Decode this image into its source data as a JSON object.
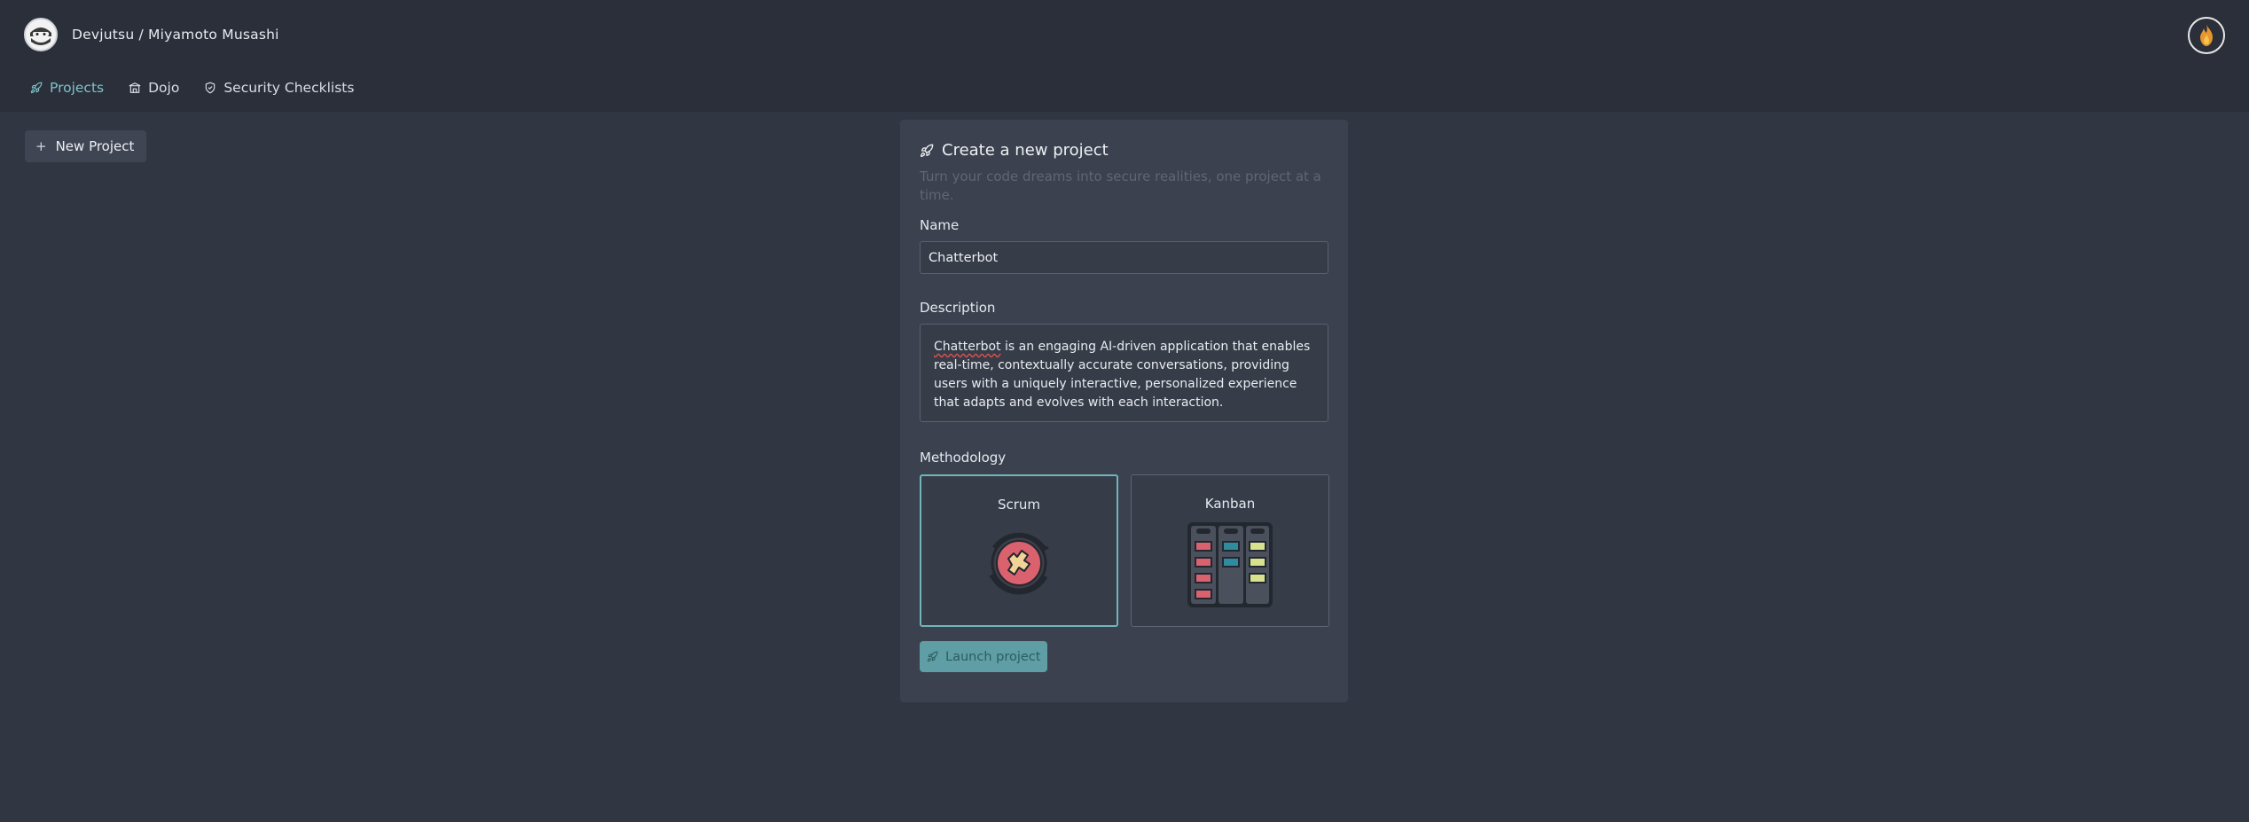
{
  "header": {
    "breadcrumb": "Devjutsu / Miyamoto Musashi",
    "logo_icon": "ninja-icon",
    "user_avatar_icon": "flame-icon"
  },
  "nav": {
    "items": [
      {
        "label": "Projects",
        "icon": "rocket-icon",
        "active": true
      },
      {
        "label": "Dojo",
        "icon": "dojo-icon",
        "active": false
      },
      {
        "label": "Security Checklists",
        "icon": "shield-icon",
        "active": false
      }
    ]
  },
  "toolbar": {
    "new_project_label": "New Project",
    "new_project_icon": "plus-icon"
  },
  "form": {
    "title": "Create a new project",
    "subtitle": "Turn your code dreams into secure realities, one project at a time.",
    "name_label": "Name",
    "name_value": "Chatterbot",
    "description_label": "Description",
    "description_first_word": "Chatterbot",
    "description_rest": " is an engaging AI-driven application that enables real-time, contextually accurate conversations, providing users with a uniquely interactive, personalized experience that adapts and evolves with each interaction.",
    "methodology_label": "Methodology",
    "methodologies": [
      {
        "label": "Scrum",
        "selected": true,
        "icon": "scrum-cycle-icon"
      },
      {
        "label": "Kanban",
        "selected": false,
        "icon": "kanban-board-icon"
      }
    ],
    "launch_label": "Launch project"
  },
  "colors": {
    "background": "#303642",
    "topbar": "#2a2f3a",
    "card": "#3b414e",
    "accent": "#6fb6bc",
    "launch_button": "#5f9ea4"
  }
}
